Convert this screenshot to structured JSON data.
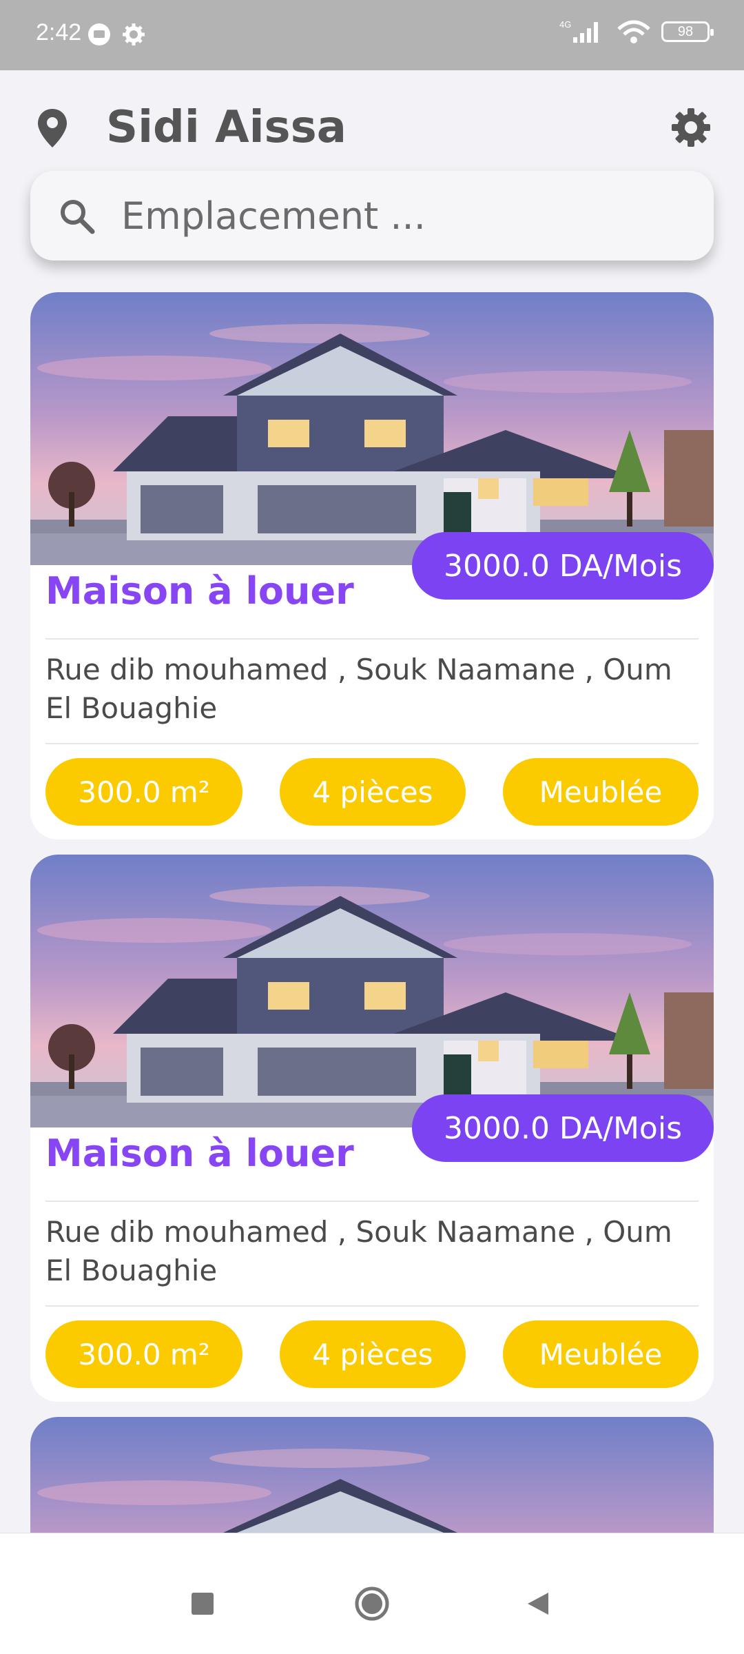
{
  "status_bar": {
    "time": "2:42",
    "battery": "98",
    "network": "4G"
  },
  "header": {
    "city": "Sidi Aissa"
  },
  "search": {
    "placeholder": "Emplacement ..."
  },
  "listings": [
    {
      "price": "3000.0 DA/Mois",
      "title": "Maison à louer",
      "address": "Rue dib mouhamed , Souk Naamane , Oum El Bouaghie",
      "area": "300.0 m²",
      "rooms": "4 pièces",
      "furnished": "Meublée"
    },
    {
      "price": "3000.0 DA/Mois",
      "title": "Maison à louer",
      "address": "Rue dib mouhamed , Souk Naamane , Oum El Bouaghie",
      "area": "300.0 m²",
      "rooms": "4 pièces",
      "furnished": "Meublée"
    }
  ],
  "colors": {
    "accent": "#7c43f2",
    "title": "#8845f4",
    "chip": "#fbcb00",
    "background": "#f3f2f7"
  },
  "icons": {
    "location": "location-pin-icon",
    "settings": "gear-icon",
    "search": "search-icon",
    "nav": [
      "recent-apps-icon",
      "home-icon",
      "back-icon"
    ]
  }
}
